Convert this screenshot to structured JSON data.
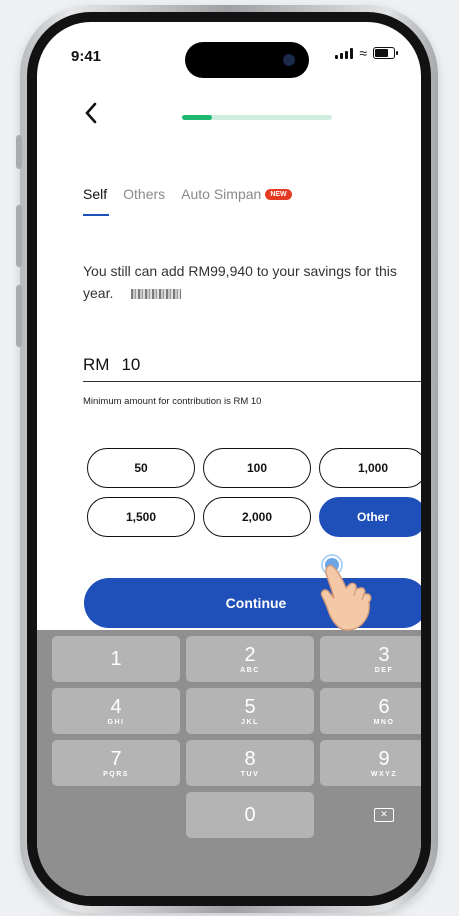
{
  "status_bar": {
    "time": "9:41"
  },
  "progress": {
    "fraction": 0.2,
    "fill_color": "#1fb86f"
  },
  "tabs": [
    {
      "label": "Self",
      "active": true
    },
    {
      "label": "Others",
      "active": false
    },
    {
      "label": "Auto Simpan",
      "active": false,
      "badge": "NEW"
    }
  ],
  "info": {
    "text": "You still can add RM99,940 to your savings for this year."
  },
  "amount": {
    "currency": "RM",
    "value": "10"
  },
  "hint": "Minimum amount for contribution is RM 10",
  "chips": [
    "50",
    "100",
    "1,000",
    "1,500",
    "2,000",
    "Other"
  ],
  "selected_chip": "Other",
  "continue_label": "Continue",
  "keypad": [
    {
      "num": "1",
      "letters": ""
    },
    {
      "num": "2",
      "letters": "ABC"
    },
    {
      "num": "3",
      "letters": "DEF"
    },
    {
      "num": "4",
      "letters": "GHI"
    },
    {
      "num": "5",
      "letters": "JKL"
    },
    {
      "num": "6",
      "letters": "MNO"
    },
    {
      "num": "7",
      "letters": "PQRS"
    },
    {
      "num": "8",
      "letters": "TUV"
    },
    {
      "num": "9",
      "letters": "WXYZ"
    },
    {
      "num": "0",
      "letters": ""
    }
  ],
  "colors": {
    "primary": "#1f4fb8",
    "badge": "#e53b22",
    "keyboard_bg": "#8f8f8f"
  },
  "icons": {
    "back": "chevron-left-icon",
    "delete": "backspace-icon",
    "pointer": "hand-pointer-icon"
  }
}
